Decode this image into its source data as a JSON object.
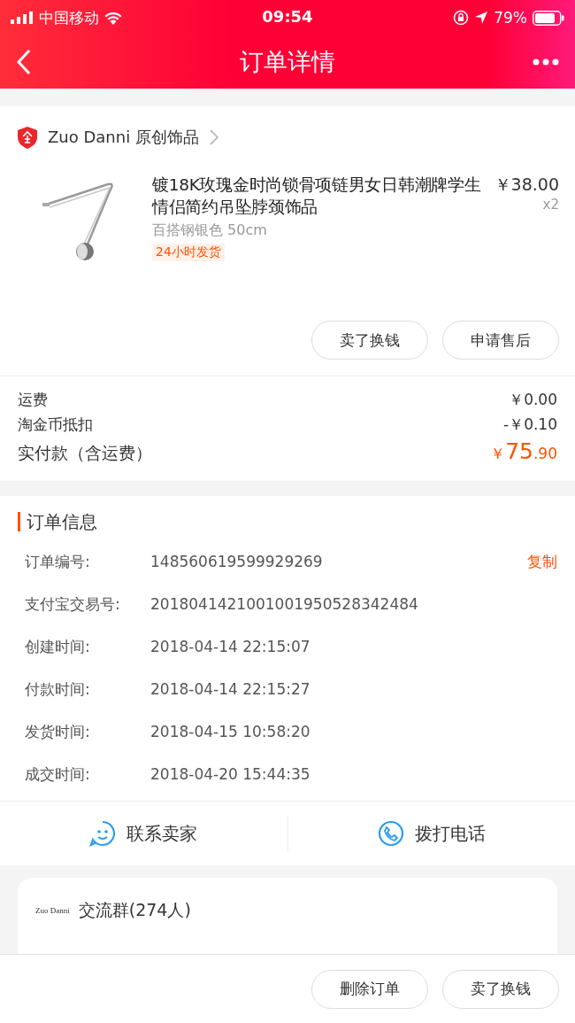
{
  "status_bar": {
    "carrier": "中国移动",
    "time": "09:54",
    "battery": "79%"
  },
  "nav": {
    "title": "订单详情"
  },
  "shop": {
    "name": "Zuo Danni 原创饰品"
  },
  "item": {
    "kind": "picture",
    "title": "镀18K玫瑰金时尚锁骨项链男女日韩潮牌学生情侣简约吊坠脖颈饰品",
    "price": "￥38.00",
    "quantity": "x2",
    "spec": "百搭钢银色 50cm",
    "tag": "24小时发货"
  },
  "item_actions": [
    "卖了换钱",
    "申请售后"
  ],
  "fees": [
    {
      "label": "运费",
      "value": "￥0.00"
    },
    {
      "label": "淘金币抵扣",
      "value": "-￥0.10"
    }
  ],
  "total": {
    "label": "实付款（含运费）",
    "currency": "￥",
    "integer": "75",
    "decimal": ".90"
  },
  "order_info": {
    "title": "订单信息",
    "rows": [
      {
        "label": "订单编号:",
        "value": "148560619599929269",
        "action": "复制"
      },
      {
        "label": "支付宝交易号:",
        "value": "2018041421001001950528342484"
      },
      {
        "label": "创建时间:",
        "value": "2018-04-14 22:15:07"
      },
      {
        "label": "付款时间:",
        "value": "2018-04-14 22:15:27"
      },
      {
        "label": "发货时间:",
        "value": "2018-04-15 10:58:20"
      },
      {
        "label": "成交时间:",
        "value": "2018-04-20 15:44:35"
      }
    ]
  },
  "contact": [
    {
      "kind": "chat",
      "label": "联系卖家"
    },
    {
      "kind": "phone",
      "label": "拨打电话"
    }
  ],
  "group": {
    "logo": "Zuo Danni",
    "title": "交流群(274人)"
  },
  "bottom_actions": [
    "删除订单",
    "卖了换钱"
  ]
}
